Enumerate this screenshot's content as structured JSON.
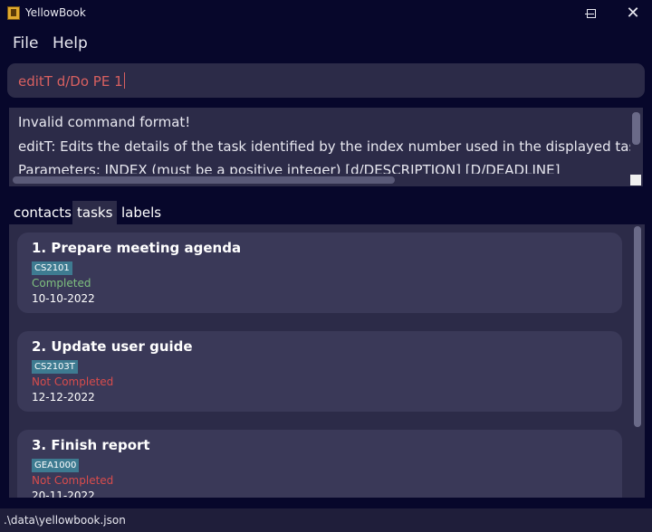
{
  "window": {
    "title": "YellowBook",
    "minimize_icon": "minimize-icon",
    "maximize_icon": "maximize-icon",
    "close_icon": "close-icon",
    "close_glyph": "✕"
  },
  "menu": {
    "file_label": "File",
    "help_label": "Help"
  },
  "command": {
    "value": "editT d/Do PE 1"
  },
  "result": {
    "lines": [
      "Invalid command format!",
      "editT: Edits the details of the task identified by the index number used in the displayed task list.",
      "Parameters: INDEX (must be a positive integer) [d/DESCRIPTION] [D/DEADLINE]"
    ]
  },
  "tabs": {
    "contacts": "contacts",
    "tasks": "tasks",
    "labels": "labels",
    "active": "tasks"
  },
  "colors": {
    "completed": "#7fc07f",
    "not_completed": "#d84c4c",
    "tag": "#3e7b91",
    "background": "#07072b",
    "panel": "#2c2b48",
    "card": "#3a3958"
  },
  "tasks": [
    {
      "title": "1.  Prepare meeting agenda",
      "tag": "CS2101",
      "status": "Completed",
      "status_type": "completed",
      "date": "10-10-2022"
    },
    {
      "title": "2.  Update user guide",
      "tag": "CS2103T",
      "status": "Not Completed",
      "status_type": "not_completed",
      "date": "12-12-2022"
    },
    {
      "title": "3.  Finish report",
      "tag": "GEA1000",
      "status": "Not Completed",
      "status_type": "not_completed",
      "date": "20-11-2022"
    }
  ],
  "statusbar": {
    "path": ".\\data\\yellowbook.json"
  }
}
